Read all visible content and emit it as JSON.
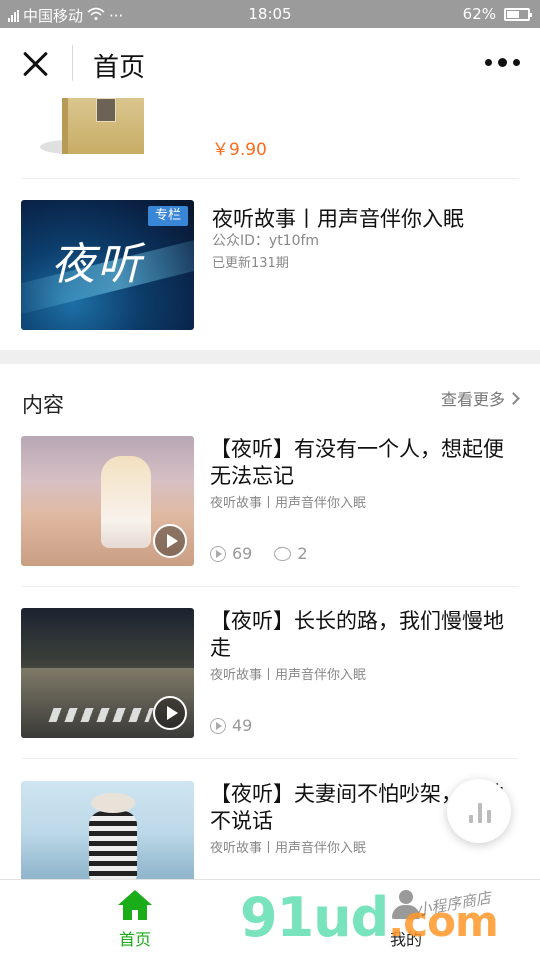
{
  "status_bar": {
    "carrier": "中国移动",
    "extra": "···",
    "time": "18:05",
    "battery": "62%",
    "battery_level": 0.62
  },
  "header": {
    "title": "首页"
  },
  "product": {
    "price": "￥9.90"
  },
  "album": {
    "tag": "专栏",
    "cover_text": "夜听",
    "title": "夜听故事丨用声音伴你入眠",
    "account_id": "公众ID：yt10fm",
    "updated": "已更新131期"
  },
  "content_section": {
    "title": "内容",
    "see_more": "查看更多"
  },
  "items": [
    {
      "title": "【夜听】有没有一个人，想起便无法忘记",
      "source": "夜听故事丨用声音伴你入眠",
      "plays": "69",
      "comments": "2"
    },
    {
      "title": "【夜听】长长的路，我们慢慢地走",
      "source": "夜听故事丨用声音伴你入眠",
      "plays": "49"
    },
    {
      "title": "【夜听】夫妻间不怕吵架，就怕不说话",
      "source": "夜听故事丨用声音伴你入眠"
    }
  ],
  "tabbar": {
    "home": "首页",
    "mine": "我的"
  },
  "watermark": {
    "text1": "91ud",
    "text2": ".com",
    "sub": "小程序商店"
  },
  "colors": {
    "accent": "#1aad19",
    "price": "#ff6a1a",
    "tag": "#3a86d6"
  }
}
